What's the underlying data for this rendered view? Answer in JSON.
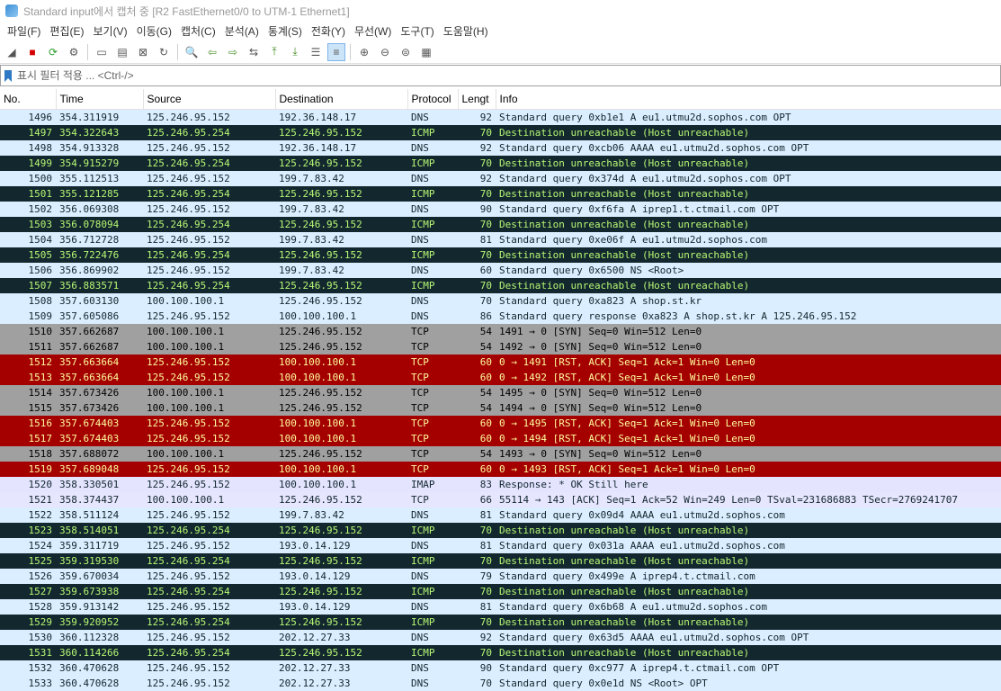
{
  "window": {
    "title": "Standard input에서 캡처 중 [R2 FastEthernet0/0 to UTM-1 Ethernet1]"
  },
  "menu": [
    "파일(F)",
    "편집(E)",
    "보기(V)",
    "이동(G)",
    "캡처(C)",
    "분석(A)",
    "통계(S)",
    "전화(Y)",
    "무선(W)",
    "도구(T)",
    "도움말(H)"
  ],
  "toolbar": {
    "buttons": [
      {
        "name": "shark-fin-start-icon",
        "glyph": "◢"
      },
      {
        "name": "stop-capture-icon",
        "glyph": "■",
        "color": "#d40000"
      },
      {
        "name": "restart-capture-icon",
        "glyph": "⟳",
        "color": "#2f9e2f"
      },
      {
        "name": "capture-options-icon",
        "glyph": "⚙"
      },
      {
        "sep": true
      },
      {
        "name": "open-file-icon",
        "glyph": "▭"
      },
      {
        "name": "save-file-icon",
        "glyph": "▤"
      },
      {
        "name": "close-file-icon",
        "glyph": "⊠"
      },
      {
        "name": "reload-file-icon",
        "glyph": "↻"
      },
      {
        "sep": true
      },
      {
        "name": "find-packet-icon",
        "glyph": "🔍"
      },
      {
        "name": "go-back-icon",
        "glyph": "⇦",
        "color": "#4a8f2a"
      },
      {
        "name": "go-forward-icon",
        "glyph": "⇨",
        "color": "#4a8f2a"
      },
      {
        "name": "go-to-packet-icon",
        "glyph": "⇆"
      },
      {
        "name": "go-first-icon",
        "glyph": "⤒",
        "color": "#4a8f2a"
      },
      {
        "name": "go-last-icon",
        "glyph": "⤓",
        "color": "#4a8f2a"
      },
      {
        "name": "autoscroll-icon",
        "glyph": "☰"
      },
      {
        "name": "colorize-icon",
        "glyph": "≡",
        "active": true
      },
      {
        "sep": true
      },
      {
        "name": "zoom-in-icon",
        "glyph": "⊕"
      },
      {
        "name": "zoom-out-icon",
        "glyph": "⊖"
      },
      {
        "name": "zoom-normal-icon",
        "glyph": "⊜"
      },
      {
        "name": "resize-columns-icon",
        "glyph": "▦"
      }
    ]
  },
  "filter": {
    "placeholder": "표시 필터 적용 ... <Ctrl-/>"
  },
  "columns": [
    {
      "label": "No.",
      "width": 62
    },
    {
      "label": "Time",
      "width": 97
    },
    {
      "label": "Source",
      "width": 147
    },
    {
      "label": "Destination",
      "width": 147
    },
    {
      "label": "Protocol",
      "width": 56
    },
    {
      "label": "Lengt",
      "width": 42
    },
    {
      "label": "Info",
      "width": 562
    }
  ],
  "packets": [
    {
      "no": "1496",
      "time": "354.311919",
      "src": "125.246.95.152",
      "dst": "192.36.148.17",
      "proto": "DNS",
      "len": "92",
      "info": "Standard query 0xb1e1 A eu1.utmu2d.sophos.com OPT",
      "cls": "r-dns"
    },
    {
      "no": "1497",
      "time": "354.322643",
      "src": "125.246.95.254",
      "dst": "125.246.95.152",
      "proto": "ICMP",
      "len": "70",
      "info": "Destination unreachable (Host unreachable)",
      "cls": "r-icmp"
    },
    {
      "no": "1498",
      "time": "354.913328",
      "src": "125.246.95.152",
      "dst": "192.36.148.17",
      "proto": "DNS",
      "len": "92",
      "info": "Standard query 0xcb06 AAAA eu1.utmu2d.sophos.com OPT",
      "cls": "r-dns"
    },
    {
      "no": "1499",
      "time": "354.915279",
      "src": "125.246.95.254",
      "dst": "125.246.95.152",
      "proto": "ICMP",
      "len": "70",
      "info": "Destination unreachable (Host unreachable)",
      "cls": "r-icmp"
    },
    {
      "no": "1500",
      "time": "355.112513",
      "src": "125.246.95.152",
      "dst": "199.7.83.42",
      "proto": "DNS",
      "len": "92",
      "info": "Standard query 0x374d A eu1.utmu2d.sophos.com OPT",
      "cls": "r-dns"
    },
    {
      "no": "1501",
      "time": "355.121285",
      "src": "125.246.95.254",
      "dst": "125.246.95.152",
      "proto": "ICMP",
      "len": "70",
      "info": "Destination unreachable (Host unreachable)",
      "cls": "r-icmp"
    },
    {
      "no": "1502",
      "time": "356.069308",
      "src": "125.246.95.152",
      "dst": "199.7.83.42",
      "proto": "DNS",
      "len": "90",
      "info": "Standard query 0xf6fa A iprep1.t.ctmail.com OPT",
      "cls": "r-dns"
    },
    {
      "no": "1503",
      "time": "356.078094",
      "src": "125.246.95.254",
      "dst": "125.246.95.152",
      "proto": "ICMP",
      "len": "70",
      "info": "Destination unreachable (Host unreachable)",
      "cls": "r-icmp"
    },
    {
      "no": "1504",
      "time": "356.712728",
      "src": "125.246.95.152",
      "dst": "199.7.83.42",
      "proto": "DNS",
      "len": "81",
      "info": "Standard query 0xe06f A eu1.utmu2d.sophos.com",
      "cls": "r-dns"
    },
    {
      "no": "1505",
      "time": "356.722476",
      "src": "125.246.95.254",
      "dst": "125.246.95.152",
      "proto": "ICMP",
      "len": "70",
      "info": "Destination unreachable (Host unreachable)",
      "cls": "r-icmp"
    },
    {
      "no": "1506",
      "time": "356.869902",
      "src": "125.246.95.152",
      "dst": "199.7.83.42",
      "proto": "DNS",
      "len": "60",
      "info": "Standard query 0x6500 NS <Root>",
      "cls": "r-dns"
    },
    {
      "no": "1507",
      "time": "356.883571",
      "src": "125.246.95.254",
      "dst": "125.246.95.152",
      "proto": "ICMP",
      "len": "70",
      "info": "Destination unreachable (Host unreachable)",
      "cls": "r-icmp"
    },
    {
      "no": "1508",
      "time": "357.603130",
      "src": "100.100.100.1",
      "dst": "125.246.95.152",
      "proto": "DNS",
      "len": "70",
      "info": "Standard query 0xa823 A shop.st.kr",
      "cls": "r-dns"
    },
    {
      "no": "1509",
      "time": "357.605086",
      "src": "125.246.95.152",
      "dst": "100.100.100.1",
      "proto": "DNS",
      "len": "86",
      "info": "Standard query response 0xa823 A shop.st.kr A 125.246.95.152",
      "cls": "r-dns"
    },
    {
      "no": "1510",
      "time": "357.662687",
      "src": "100.100.100.1",
      "dst": "125.246.95.152",
      "proto": "TCP",
      "len": "54",
      "info": "1491 → 0 [SYN] Seq=0 Win=512 Len=0",
      "cls": "r-tcp-syn"
    },
    {
      "no": "1511",
      "time": "357.662687",
      "src": "100.100.100.1",
      "dst": "125.246.95.152",
      "proto": "TCP",
      "len": "54",
      "info": "1492 → 0 [SYN] Seq=0 Win=512 Len=0",
      "cls": "r-tcp-syn"
    },
    {
      "no": "1512",
      "time": "357.663664",
      "src": "125.246.95.152",
      "dst": "100.100.100.1",
      "proto": "TCP",
      "len": "60",
      "info": "0 → 1491 [RST, ACK] Seq=1 Ack=1 Win=0 Len=0",
      "cls": "r-tcp-rst"
    },
    {
      "no": "1513",
      "time": "357.663664",
      "src": "125.246.95.152",
      "dst": "100.100.100.1",
      "proto": "TCP",
      "len": "60",
      "info": "0 → 1492 [RST, ACK] Seq=1 Ack=1 Win=0 Len=0",
      "cls": "r-tcp-rst"
    },
    {
      "no": "1514",
      "time": "357.673426",
      "src": "100.100.100.1",
      "dst": "125.246.95.152",
      "proto": "TCP",
      "len": "54",
      "info": "1495 → 0 [SYN] Seq=0 Win=512 Len=0",
      "cls": "r-tcp-syn"
    },
    {
      "no": "1515",
      "time": "357.673426",
      "src": "100.100.100.1",
      "dst": "125.246.95.152",
      "proto": "TCP",
      "len": "54",
      "info": "1494 → 0 [SYN] Seq=0 Win=512 Len=0",
      "cls": "r-tcp-syn"
    },
    {
      "no": "1516",
      "time": "357.674403",
      "src": "125.246.95.152",
      "dst": "100.100.100.1",
      "proto": "TCP",
      "len": "60",
      "info": "0 → 1495 [RST, ACK] Seq=1 Ack=1 Win=0 Len=0",
      "cls": "r-tcp-rst"
    },
    {
      "no": "1517",
      "time": "357.674403",
      "src": "125.246.95.152",
      "dst": "100.100.100.1",
      "proto": "TCP",
      "len": "60",
      "info": "0 → 1494 [RST, ACK] Seq=1 Ack=1 Win=0 Len=0",
      "cls": "r-tcp-rst"
    },
    {
      "no": "1518",
      "time": "357.688072",
      "src": "100.100.100.1",
      "dst": "125.246.95.152",
      "proto": "TCP",
      "len": "54",
      "info": "1493 → 0 [SYN] Seq=0 Win=512 Len=0",
      "cls": "r-tcp-syn"
    },
    {
      "no": "1519",
      "time": "357.689048",
      "src": "125.246.95.152",
      "dst": "100.100.100.1",
      "proto": "TCP",
      "len": "60",
      "info": "0 → 1493 [RST, ACK] Seq=1 Ack=1 Win=0 Len=0",
      "cls": "r-tcp-rst"
    },
    {
      "no": "1520",
      "time": "358.330501",
      "src": "125.246.95.152",
      "dst": "100.100.100.1",
      "proto": "IMAP",
      "len": "83",
      "info": "Response: * OK Still here",
      "cls": "r-imap"
    },
    {
      "no": "1521",
      "time": "358.374437",
      "src": "100.100.100.1",
      "dst": "125.246.95.152",
      "proto": "TCP",
      "len": "66",
      "info": "55114 → 143 [ACK] Seq=1 Ack=52 Win=249 Len=0 TSval=231686883 TSecr=2769241707",
      "cls": "r-tcp"
    },
    {
      "no": "1522",
      "time": "358.511124",
      "src": "125.246.95.152",
      "dst": "199.7.83.42",
      "proto": "DNS",
      "len": "81",
      "info": "Standard query 0x09d4 AAAA eu1.utmu2d.sophos.com",
      "cls": "r-dns"
    },
    {
      "no": "1523",
      "time": "358.514051",
      "src": "125.246.95.254",
      "dst": "125.246.95.152",
      "proto": "ICMP",
      "len": "70",
      "info": "Destination unreachable (Host unreachable)",
      "cls": "r-icmp"
    },
    {
      "no": "1524",
      "time": "359.311719",
      "src": "125.246.95.152",
      "dst": "193.0.14.129",
      "proto": "DNS",
      "len": "81",
      "info": "Standard query 0x031a AAAA eu1.utmu2d.sophos.com",
      "cls": "r-dns"
    },
    {
      "no": "1525",
      "time": "359.319530",
      "src": "125.246.95.254",
      "dst": "125.246.95.152",
      "proto": "ICMP",
      "len": "70",
      "info": "Destination unreachable (Host unreachable)",
      "cls": "r-icmp"
    },
    {
      "no": "1526",
      "time": "359.670034",
      "src": "125.246.95.152",
      "dst": "193.0.14.129",
      "proto": "DNS",
      "len": "79",
      "info": "Standard query 0x499e A iprep4.t.ctmail.com",
      "cls": "r-dns"
    },
    {
      "no": "1527",
      "time": "359.673938",
      "src": "125.246.95.254",
      "dst": "125.246.95.152",
      "proto": "ICMP",
      "len": "70",
      "info": "Destination unreachable (Host unreachable)",
      "cls": "r-icmp"
    },
    {
      "no": "1528",
      "time": "359.913142",
      "src": "125.246.95.152",
      "dst": "193.0.14.129",
      "proto": "DNS",
      "len": "81",
      "info": "Standard query 0x6b68 A eu1.utmu2d.sophos.com",
      "cls": "r-dns"
    },
    {
      "no": "1529",
      "time": "359.920952",
      "src": "125.246.95.254",
      "dst": "125.246.95.152",
      "proto": "ICMP",
      "len": "70",
      "info": "Destination unreachable (Host unreachable)",
      "cls": "r-icmp"
    },
    {
      "no": "1530",
      "time": "360.112328",
      "src": "125.246.95.152",
      "dst": "202.12.27.33",
      "proto": "DNS",
      "len": "92",
      "info": "Standard query 0x63d5 AAAA eu1.utmu2d.sophos.com OPT",
      "cls": "r-dns"
    },
    {
      "no": "1531",
      "time": "360.114266",
      "src": "125.246.95.254",
      "dst": "125.246.95.152",
      "proto": "ICMP",
      "len": "70",
      "info": "Destination unreachable (Host unreachable)",
      "cls": "r-icmp"
    },
    {
      "no": "1532",
      "time": "360.470628",
      "src": "125.246.95.152",
      "dst": "202.12.27.33",
      "proto": "DNS",
      "len": "90",
      "info": "Standard query 0xc977 A iprep4.t.ctmail.com OPT",
      "cls": "r-dns"
    },
    {
      "no": "1533",
      "time": "360.470628",
      "src": "125.246.95.152",
      "dst": "202.12.27.33",
      "proto": "DNS",
      "len": "70",
      "info": "Standard query 0x0e1d NS <Root> OPT",
      "cls": "r-dns"
    }
  ]
}
